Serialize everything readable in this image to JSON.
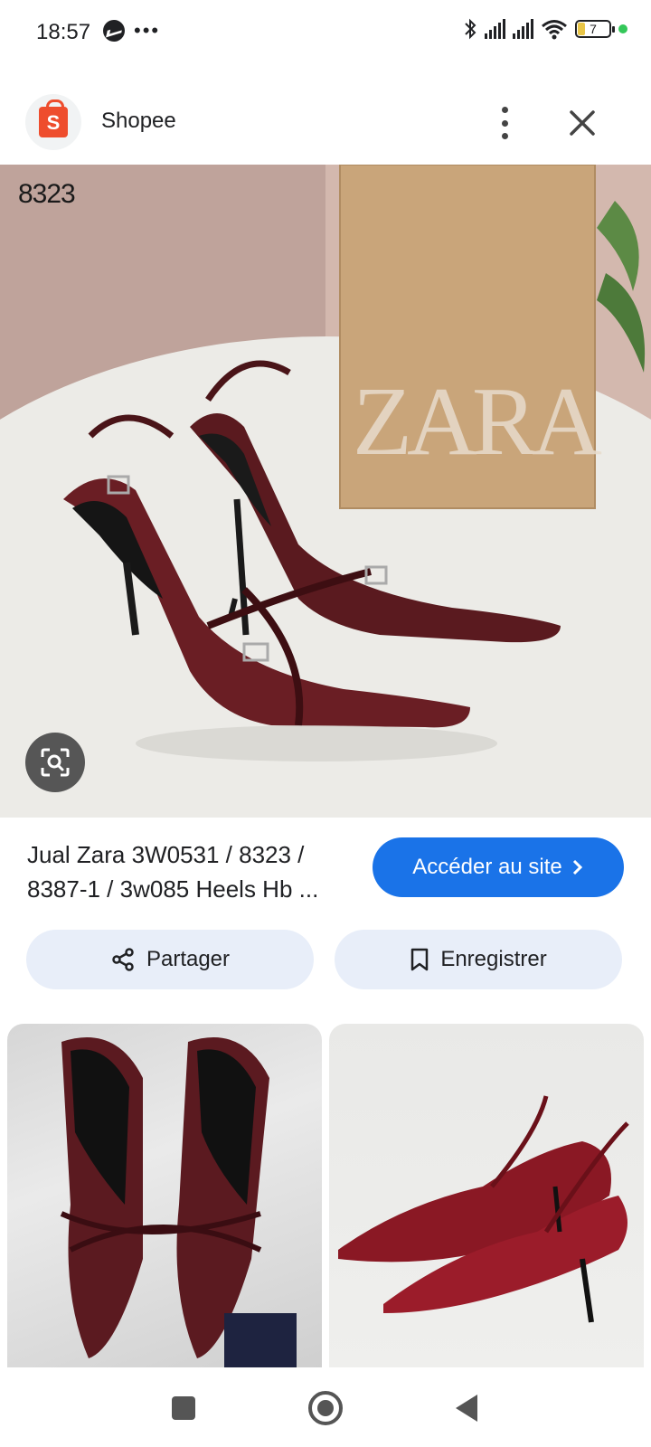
{
  "status_bar": {
    "time": "18:57",
    "battery_level": "7",
    "icons": [
      "messenger-icon",
      "more-dots-icon",
      "bluetooth-icon",
      "signal-icon",
      "signal-icon",
      "wifi-icon",
      "battery-icon",
      "green-dot-indicator"
    ]
  },
  "header": {
    "app_name": "Shopee",
    "app_icon": "shopee-bag-icon",
    "app_icon_letter": "S",
    "brand_color": "#ee4d2d"
  },
  "image": {
    "overlay_label": "8323",
    "box_brand_text": "ZARA",
    "lens_icon": "lens-search-icon"
  },
  "result": {
    "title": "Jual Zara 3W0531 / 8323 / 8387-1 / 3w085 Heels Hb ...",
    "visit_label": "Accéder au site",
    "visit_color": "#1a73e8"
  },
  "actions": {
    "share_label": "Partager",
    "save_label": "Enregistrer"
  },
  "navigation": {
    "buttons": [
      "recents-square-icon",
      "home-circle-icon",
      "back-triangle-icon"
    ]
  }
}
